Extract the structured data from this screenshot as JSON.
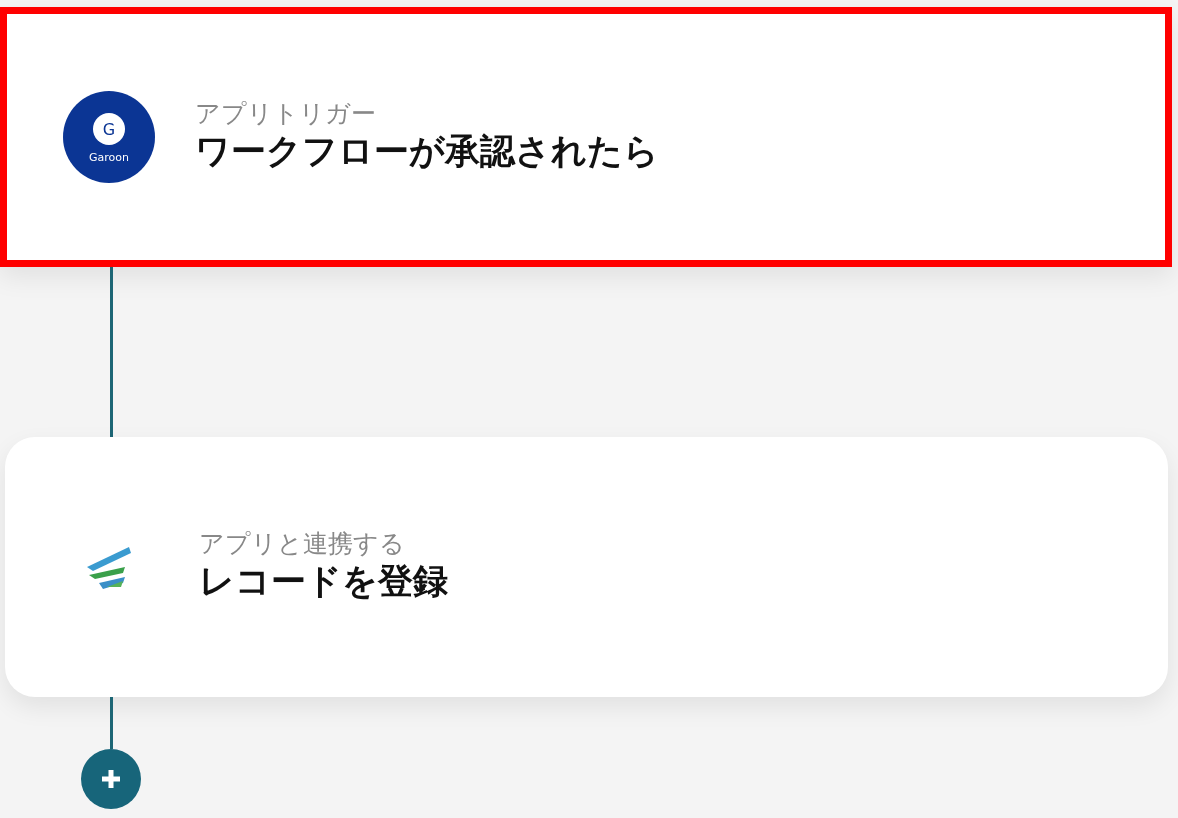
{
  "steps": [
    {
      "kind": "garoon",
      "logo_letter": "G",
      "logo_text": "Garoon",
      "label": "アプリトリガー",
      "title": "ワークフローが承認されたら",
      "highlighted": true
    },
    {
      "kind": "spiral",
      "label": "アプリと連携する",
      "title": "レコードを登録",
      "highlighted": false
    }
  ]
}
